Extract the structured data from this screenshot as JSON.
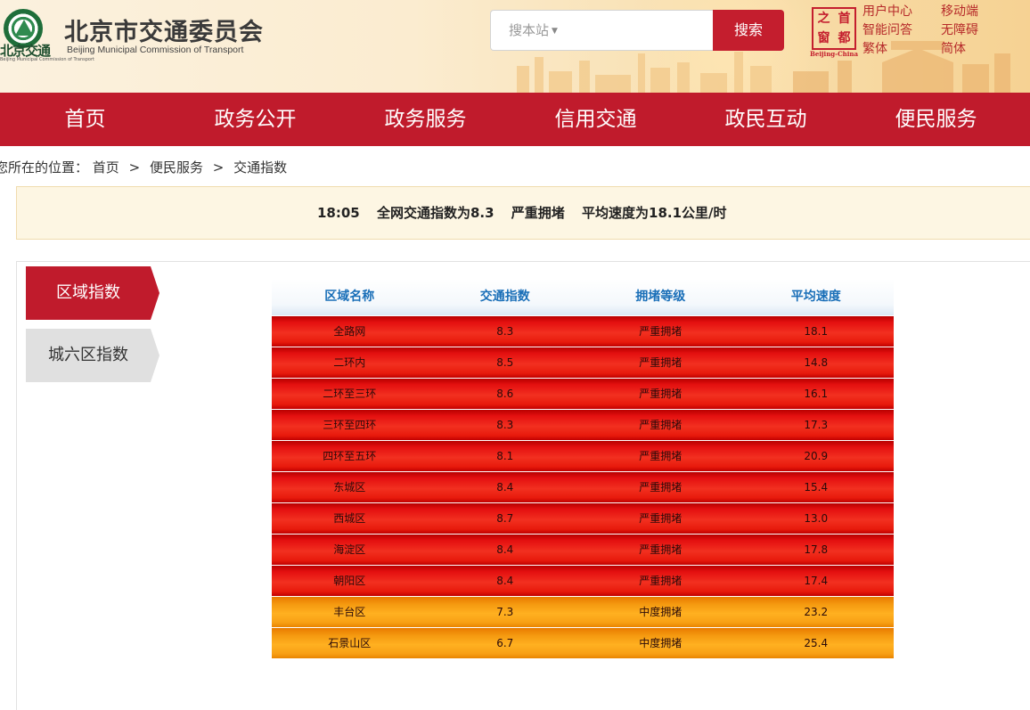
{
  "header": {
    "logo_short": "北京交通",
    "logo_tiny": "Beijing Municipal Commission of Transport",
    "title": "北京市交通委员会",
    "subtitle": "Beijing Municipal Commission of Transport",
    "search_placeholder": "搜本站",
    "search_button": "搜索",
    "seal_chars": [
      "首",
      "都",
      "之",
      "窗"
    ],
    "seal_sub": "Beijing-China",
    "links_left": [
      "用户中心",
      "智能问答",
      "繁体"
    ],
    "links_right": [
      "移动端",
      "无障碍",
      "简体"
    ]
  },
  "nav": [
    "首页",
    "政务公开",
    "政务服务",
    "信用交通",
    "政民互动",
    "便民服务"
  ],
  "breadcrumb": {
    "prefix": "您所在的位置：",
    "items": [
      "首页",
      "便民服务",
      "交通指数"
    ],
    "separator": ">"
  },
  "status": {
    "time": "18:05",
    "index_text": "全网交通指数为8.3",
    "level_text": "严重拥堵",
    "speed_text": "平均速度为18.1公里/时"
  },
  "side_tabs": {
    "active": "区域指数",
    "inactive": "城六区指数"
  },
  "table": {
    "headers": [
      "区域名称",
      "交通指数",
      "拥堵等级",
      "平均速度"
    ],
    "rows": [
      {
        "name": "全路网",
        "index": "8.3",
        "level": "严重拥堵",
        "speed": "18.1",
        "type": "severe"
      },
      {
        "name": "二环内",
        "index": "8.5",
        "level": "严重拥堵",
        "speed": "14.8",
        "type": "severe"
      },
      {
        "name": "二环至三环",
        "index": "8.6",
        "level": "严重拥堵",
        "speed": "16.1",
        "type": "severe"
      },
      {
        "name": "三环至四环",
        "index": "8.3",
        "level": "严重拥堵",
        "speed": "17.3",
        "type": "severe"
      },
      {
        "name": "四环至五环",
        "index": "8.1",
        "level": "严重拥堵",
        "speed": "20.9",
        "type": "severe"
      },
      {
        "name": "东城区",
        "index": "8.4",
        "level": "严重拥堵",
        "speed": "15.4",
        "type": "severe"
      },
      {
        "name": "西城区",
        "index": "8.7",
        "level": "严重拥堵",
        "speed": "13.0",
        "type": "severe"
      },
      {
        "name": "海淀区",
        "index": "8.4",
        "level": "严重拥堵",
        "speed": "17.8",
        "type": "severe"
      },
      {
        "name": "朝阳区",
        "index": "8.4",
        "level": "严重拥堵",
        "speed": "17.4",
        "type": "severe"
      },
      {
        "name": "丰台区",
        "index": "7.3",
        "level": "中度拥堵",
        "speed": "23.2",
        "type": "moderate"
      },
      {
        "name": "石景山区",
        "index": "6.7",
        "level": "中度拥堵",
        "speed": "25.4",
        "type": "moderate"
      }
    ]
  },
  "colors": {
    "brand_red": "#c01b2c",
    "severe": "#e41010",
    "moderate": "#f59a10",
    "header_blue": "#1a6fb8"
  }
}
